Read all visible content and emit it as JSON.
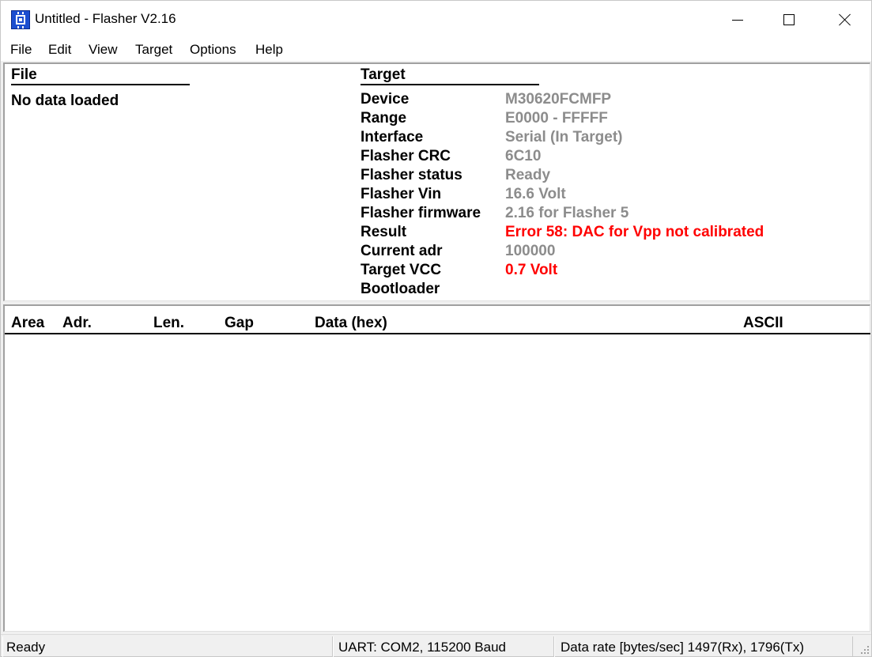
{
  "window": {
    "title": "Untitled - Flasher V2.16",
    "icon": "flasher-chip-icon"
  },
  "menu": [
    "File",
    "Edit",
    "View",
    "Target",
    "Options",
    "Help"
  ],
  "file_section": {
    "heading": "File",
    "status": "No data loaded"
  },
  "target_section": {
    "heading": "Target",
    "rows": [
      {
        "label": "Device",
        "value": "M30620FCMFP",
        "state": "normal"
      },
      {
        "label": "Range",
        "value": "E0000 - FFFFF",
        "state": "normal"
      },
      {
        "label": "Interface",
        "value": "Serial (In Target)",
        "state": "normal"
      },
      {
        "label": "Flasher CRC",
        "value": "6C10",
        "state": "normal"
      },
      {
        "label": "Flasher status",
        "value": "Ready",
        "state": "normal"
      },
      {
        "label": "Flasher Vin",
        "value": "16.6 Volt",
        "state": "normal"
      },
      {
        "label": "Flasher firmware",
        "value": "2.16 for Flasher 5",
        "state": "normal"
      },
      {
        "label": "Result",
        "value": "Error 58: DAC for Vpp not calibrated",
        "state": "error"
      },
      {
        "label": "Current adr",
        "value": "100000",
        "state": "normal"
      },
      {
        "label": "Target VCC",
        "value": "0.7 Volt",
        "state": "error"
      },
      {
        "label": "Bootloader",
        "value": "",
        "state": "normal"
      }
    ]
  },
  "data_table": {
    "columns": [
      "Area",
      "Adr.",
      "Len.",
      "Gap",
      "Data (hex)",
      "ASCII"
    ]
  },
  "statusbar": {
    "state": "Ready",
    "connection": "UART: COM2, 115200 Baud",
    "data_rate": "Data rate [bytes/sec] 1497(Rx), 1796(Tx)"
  },
  "colors": {
    "value_normal": "#8c8c8c",
    "value_error": "#ff0000",
    "icon_blue": "#1c4fd0"
  }
}
